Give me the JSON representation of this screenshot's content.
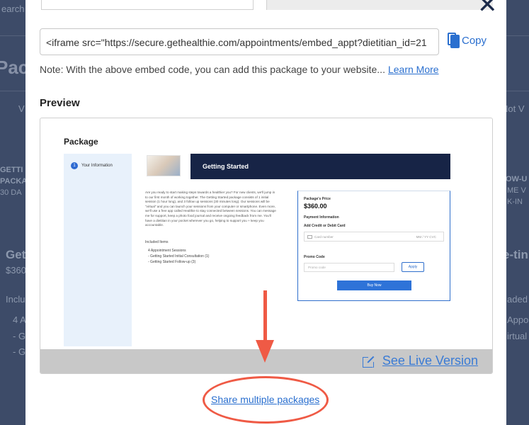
{
  "background": {
    "fragments": [
      "earch",
      "Pack",
      "V",
      "Not V",
      "GETTI",
      "PACKA",
      "30 DA",
      "OW-U",
      "ME V",
      "K-IN",
      "Get",
      "$360",
      "e-tin",
      "Inclu",
      "aded",
      "4 A",
      "Appo",
      "- G",
      "irtual",
      "- G"
    ]
  },
  "embed": {
    "code": "<iframe src=\"https://secure.gethealthie.com/appointments/embed_appt?dietitian_id=21",
    "copy_label": "Copy"
  },
  "note": {
    "text": "Note: With the above embed code, you can add this package to your website...",
    "link": "Learn More"
  },
  "preview": {
    "title": "Preview",
    "package_heading": "Package",
    "step_num": "1",
    "step_label": "Your Information",
    "banner": "Getting Started",
    "description": "Are you ready to start making steps towards a healthier you? For new clients, we'll jump in to our first month of working together. The Getting Started package consists of 1 initial session (1 hour long), and 3 follow up sessions (30 minutes long). Our sessions will be \"virtual\" and you can launch your sessions from your computer or smartphone. Even more, we'll use a free app called Healthie to stay connected between sessions. You can message me for support, keep a photo food journal and receive ongoing feedback from me. You'll have a dietitian in your pocket wherever you go, helping to support you + keep you accountable.",
    "included_title": "Included Items",
    "included_items": [
      "4 Appointment Sessions",
      "- Getting Started Initial Consultation (1)",
      "- Getting Started Follow-up (3)"
    ],
    "card": {
      "price_label": "Package's Price",
      "price": "$360.00",
      "payment_label": "Payment Information",
      "card_label": "Add Credit or Debit Card",
      "card_placeholder": "Card number",
      "card_expiry": "MM / YY  CVC",
      "promo_label": "Promo Code",
      "promo_placeholder": "Promo code",
      "apply": "Apply",
      "buy": "Buy Now"
    },
    "live_link": "See Live Version"
  },
  "share_link": "Share multiple packages",
  "colors": {
    "accent": "#2a6fcf",
    "banner": "#172446",
    "annotation": "#ef5a45"
  }
}
